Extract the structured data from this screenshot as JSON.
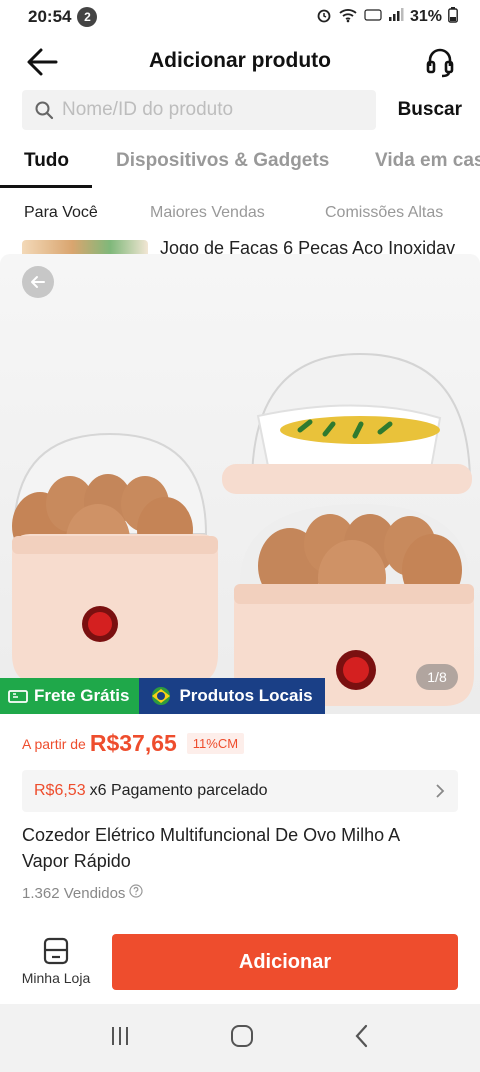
{
  "status_bar": {
    "time": "20:54",
    "notification_count": "2",
    "battery": "31%"
  },
  "header": {
    "title": "Adicionar produto"
  },
  "search": {
    "placeholder": "Nome/ID do produto",
    "button_label": "Buscar"
  },
  "tabs": [
    {
      "label": "Tudo",
      "active": true
    },
    {
      "label": "Dispositivos & Gadgets",
      "active": false
    },
    {
      "label": "Vida em cas",
      "active": false
    }
  ],
  "subtabs": [
    {
      "label": "Para Você",
      "active": true
    },
    {
      "label": "Maiores Vendas",
      "active": false
    },
    {
      "label": "Comissões Altas",
      "active": false
    }
  ],
  "list_peek": {
    "title": "Jogo de Facas 6 Peças Aço Inoxidav"
  },
  "product": {
    "image_counter": "1/8",
    "badges": {
      "frete": "Frete Grátis",
      "locais": "Produtos Locais"
    },
    "price_prefix": "A partir de",
    "price": "R$37,65",
    "commission": "11%CM",
    "installment": {
      "amount": "R$6,53",
      "text": "x6 Pagamento parcelado"
    },
    "name": "Cozedor Elétrico Multifuncional De Ovo Milho A Vapor Rápido",
    "sold": "1.362 Vendidos"
  },
  "bottom": {
    "store_label": "Minha Loja",
    "add_label": "Adicionar"
  },
  "colors": {
    "accent": "#ee4d2d",
    "frete_green": "#1fa84a",
    "locais_blue": "#1a3f86"
  }
}
